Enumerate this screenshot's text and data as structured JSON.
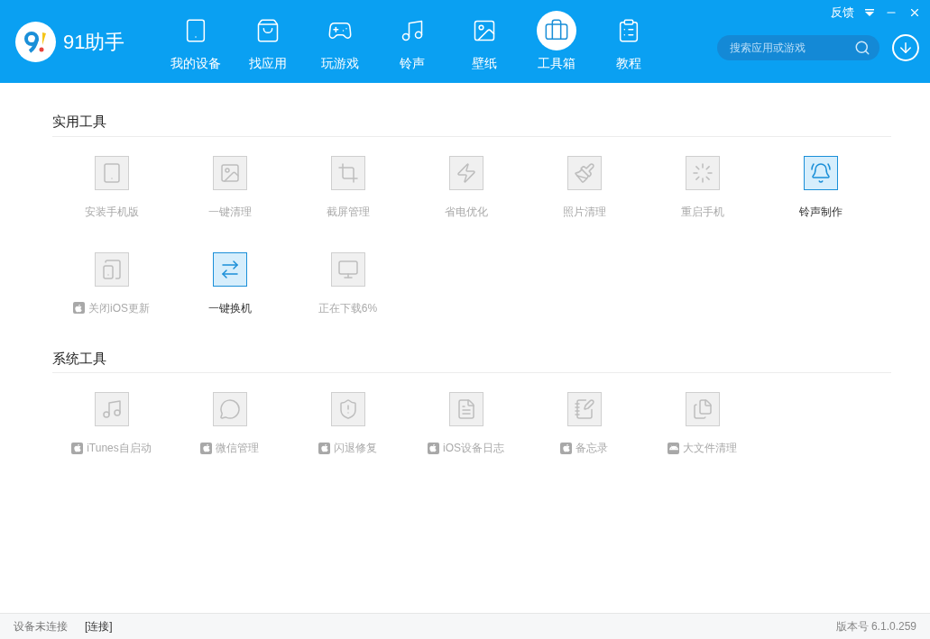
{
  "header": {
    "logo_text": "91助手",
    "nav": [
      {
        "label": "我的设备",
        "kind": "device",
        "selected": false
      },
      {
        "label": "找应用",
        "kind": "bag",
        "selected": false
      },
      {
        "label": "玩游戏",
        "kind": "game",
        "selected": false
      },
      {
        "label": "铃声",
        "kind": "music",
        "selected": false
      },
      {
        "label": "壁纸",
        "kind": "image",
        "selected": false
      },
      {
        "label": "工具箱",
        "kind": "toolbox",
        "selected": true
      },
      {
        "label": "教程",
        "kind": "clipboard",
        "selected": false
      }
    ],
    "feedback": "反馈",
    "search": {
      "placeholder": "搜索应用或游戏"
    }
  },
  "sections": [
    {
      "title": "实用工具",
      "tools": [
        {
          "label": "安装手机版",
          "kind": "tablet",
          "enabled": false
        },
        {
          "label": "一键清理",
          "kind": "image",
          "enabled": false
        },
        {
          "label": "截屏管理",
          "kind": "crop",
          "enabled": false
        },
        {
          "label": "省电优化",
          "kind": "zap",
          "enabled": false
        },
        {
          "label": "照片清理",
          "kind": "brush",
          "enabled": false
        },
        {
          "label": "重启手机",
          "kind": "loader",
          "enabled": false
        },
        {
          "label": "铃声制作",
          "kind": "bell",
          "enabled": true
        },
        {
          "label": "关闭iOS更新",
          "kind": "block",
          "enabled": false,
          "badge": {
            "kind": "apple"
          }
        },
        {
          "label": "一键换机",
          "kind": "transfer",
          "enabled": true
        },
        {
          "label": "正在下载6%",
          "kind": "vr",
          "enabled": false
        }
      ]
    },
    {
      "title": "系统工具",
      "tools": [
        {
          "label": "iTunes自启动",
          "kind": "music",
          "enabled": false,
          "badge": {
            "kind": "apple"
          }
        },
        {
          "label": "微信管理",
          "kind": "chat",
          "enabled": false,
          "badge": {
            "kind": "apple"
          }
        },
        {
          "label": "闪退修复",
          "kind": "shield",
          "enabled": false,
          "badge": {
            "kind": "apple"
          }
        },
        {
          "label": "iOS设备日志",
          "kind": "log",
          "enabled": false,
          "badge": {
            "kind": "apple"
          }
        },
        {
          "label": "备忘录",
          "kind": "notes",
          "enabled": false,
          "badge": {
            "kind": "apple"
          }
        },
        {
          "label": "大文件清理",
          "kind": "files",
          "enabled": false,
          "badge": {
            "kind": "android"
          }
        }
      ]
    }
  ],
  "status_bar": {
    "connection": "设备未连接",
    "connect_link": "[连接]",
    "version": "版本号 6.1.0.259"
  }
}
